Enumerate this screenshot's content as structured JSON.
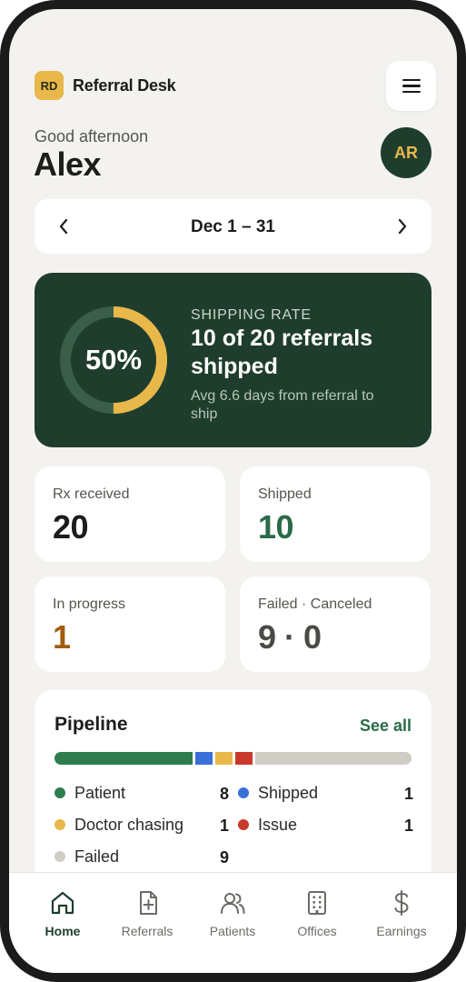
{
  "brand": {
    "logo_text": "RD",
    "name": "Referral Desk"
  },
  "header": {
    "greeting": "Good afternoon",
    "user_name": "Alex",
    "avatar_initials": "AR",
    "menu_icon": "hamburger-icon"
  },
  "date_range": {
    "label": "Dec 1 – 31",
    "prev_icon": "chevron-left-icon",
    "next_icon": "chevron-right-icon"
  },
  "shipping_rate": {
    "percent_label": "50%",
    "percent_value": 0.5,
    "eyebrow": "SHIPPING RATE",
    "headline": "10 of 20 referrals shipped",
    "subtext": "Avg 6.6 days from referral to ship"
  },
  "stats": [
    {
      "label": "Rx received",
      "value": "20",
      "color": "#1c1c1a"
    },
    {
      "label": "Shipped",
      "value": "10",
      "color": "#2a6b47"
    },
    {
      "label": "In progress",
      "value": "1",
      "color": "#a35c10"
    },
    {
      "label": "Failed · Canceled",
      "value": "9 · 0",
      "color": "#4a4a46"
    }
  ],
  "pipeline": {
    "title": "Pipeline",
    "see_all": "See all",
    "items": [
      {
        "label": "Patient",
        "count": "8",
        "color": "#2e7d4f"
      },
      {
        "label": "Shipped",
        "count": "1",
        "color": "#3b6fd8"
      },
      {
        "label": "Doctor chasing",
        "count": "1",
        "color": "#e8b84a"
      },
      {
        "label": "Issue",
        "count": "1",
        "color": "#c9392b"
      },
      {
        "label": "Failed",
        "count": "9",
        "color": "#cfcdc4"
      }
    ]
  },
  "nav": {
    "items": [
      {
        "label": "Home",
        "icon": "home-icon",
        "active": true
      },
      {
        "label": "Referrals",
        "icon": "document-plus-icon",
        "active": false
      },
      {
        "label": "Patients",
        "icon": "users-icon",
        "active": false
      },
      {
        "label": "Offices",
        "icon": "building-icon",
        "active": false
      },
      {
        "label": "Earnings",
        "icon": "dollar-icon",
        "active": false
      }
    ]
  },
  "colors": {
    "brand_dark": "#1f3d2c",
    "accent_yellow": "#e8b84a",
    "background": "#f3f2ef"
  }
}
